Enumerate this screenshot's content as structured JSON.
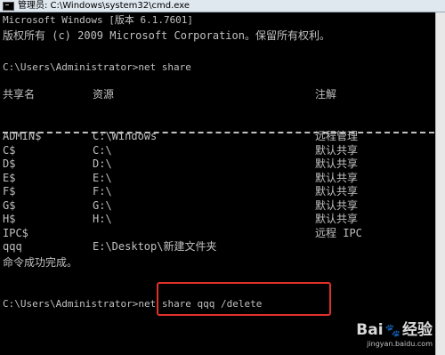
{
  "window": {
    "title": "管理员: C:\\Windows\\system32\\cmd.exe"
  },
  "console": {
    "header_line1": "Microsoft Windows [版本 6.1.7601]",
    "header_line2": "版权所有 (c) 2009 Microsoft Corporation。保留所有权利。",
    "prompt1": "C:\\Users\\Administrator>net share",
    "columns": [
      "共享名",
      "资源",
      "注解"
    ],
    "rows": [
      {
        "name": "ADMIN$",
        "resource": "C:\\Windows",
        "remark": "远程管理"
      },
      {
        "name": "C$",
        "resource": "C:\\",
        "remark": "默认共享"
      },
      {
        "name": "D$",
        "resource": "D:\\",
        "remark": "默认共享"
      },
      {
        "name": "E$",
        "resource": "E:\\",
        "remark": "默认共享"
      },
      {
        "name": "F$",
        "resource": "F:\\",
        "remark": "默认共享"
      },
      {
        "name": "G$",
        "resource": "G:\\",
        "remark": "默认共享"
      },
      {
        "name": "H$",
        "resource": "H:\\",
        "remark": "默认共享"
      },
      {
        "name": "IPC$",
        "resource": "",
        "remark": "远程 IPC"
      },
      {
        "name": "qqq",
        "resource": "E:\\Desktop\\新建文件夹",
        "remark": ""
      }
    ],
    "done": "命令成功完成。",
    "prompt2_path": "C:\\Users\\Administrator>",
    "prompt2_cmd": "net share qqq /delete"
  },
  "watermark": {
    "brand_left": "Bai",
    "brand_right": "经验",
    "paw": "🐾",
    "url": "jingyan.baidu.com"
  },
  "colors": {
    "highlight": "#e0302a",
    "console_bg": "#000000",
    "console_fg": "#c0c0c0"
  }
}
